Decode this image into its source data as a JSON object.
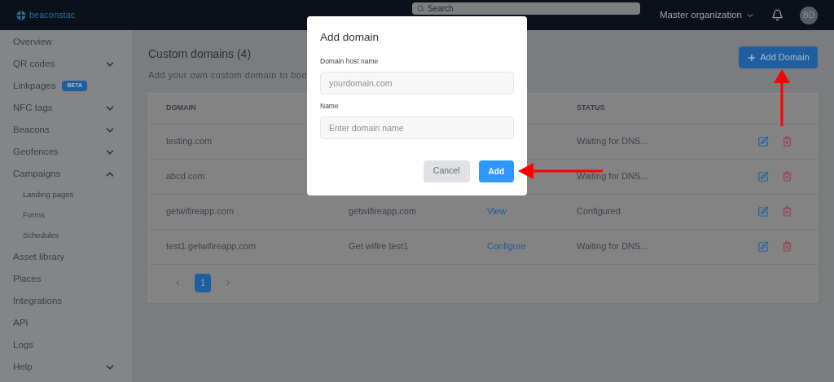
{
  "header": {
    "logo": "beaconstac",
    "search": {
      "placeholder": "Search"
    },
    "organization": "Master organization",
    "avatar": "BD"
  },
  "sidebar": {
    "items": [
      {
        "label": "Overview"
      },
      {
        "label": "QR codes",
        "expanded": false
      },
      {
        "label": "Linkpages",
        "badge": "BETA"
      },
      {
        "label": "NFC tags",
        "expanded": false
      },
      {
        "label": "Beacons",
        "expanded": false
      },
      {
        "label": "Geofences",
        "expanded": false
      },
      {
        "label": "Campaigns",
        "expanded": true,
        "children": [
          {
            "label": "Landing pages"
          },
          {
            "label": "Forms"
          },
          {
            "label": "Schedules"
          }
        ]
      },
      {
        "label": "Asset library"
      },
      {
        "label": "Places"
      },
      {
        "label": "Integrations"
      },
      {
        "label": "API"
      },
      {
        "label": "Logs"
      },
      {
        "label": "Help",
        "expanded": false
      }
    ]
  },
  "page": {
    "title": "Custom domains (4)",
    "subtitle": "Add your own custom domain to boo",
    "add_button": "Add Domain"
  },
  "table": {
    "columns": [
      {
        "label": "DOMAIN"
      },
      {
        "label": "STATUS"
      }
    ],
    "rows": [
      {
        "domain": "testing.com",
        "status": "Waiting for DNS..."
      },
      {
        "domain": "abcd.com",
        "status": "Waiting for DNS..."
      },
      {
        "domain": "getwifireapp.com",
        "column_2": "getwifireapp.com",
        "column_3": "View",
        "status": "Configured"
      },
      {
        "domain": "test1.getwifireapp.com",
        "column_2": "Get wifire test1",
        "column_3": "Configure",
        "status": "Waiting for DNS..."
      }
    ],
    "pagination": [
      {
        "label": "1",
        "selected": true
      }
    ]
  },
  "dialog": {
    "title": "Add domain",
    "fields": [
      {
        "label": "Domain host name",
        "placeholder": "yourdomain.com"
      },
      {
        "label": "Name",
        "placeholder": "Enter domain name"
      }
    ],
    "buttons": [
      {
        "label": "Cancel",
        "kind": "secondary"
      },
      {
        "label": "Add",
        "kind": "primary"
      }
    ]
  }
}
